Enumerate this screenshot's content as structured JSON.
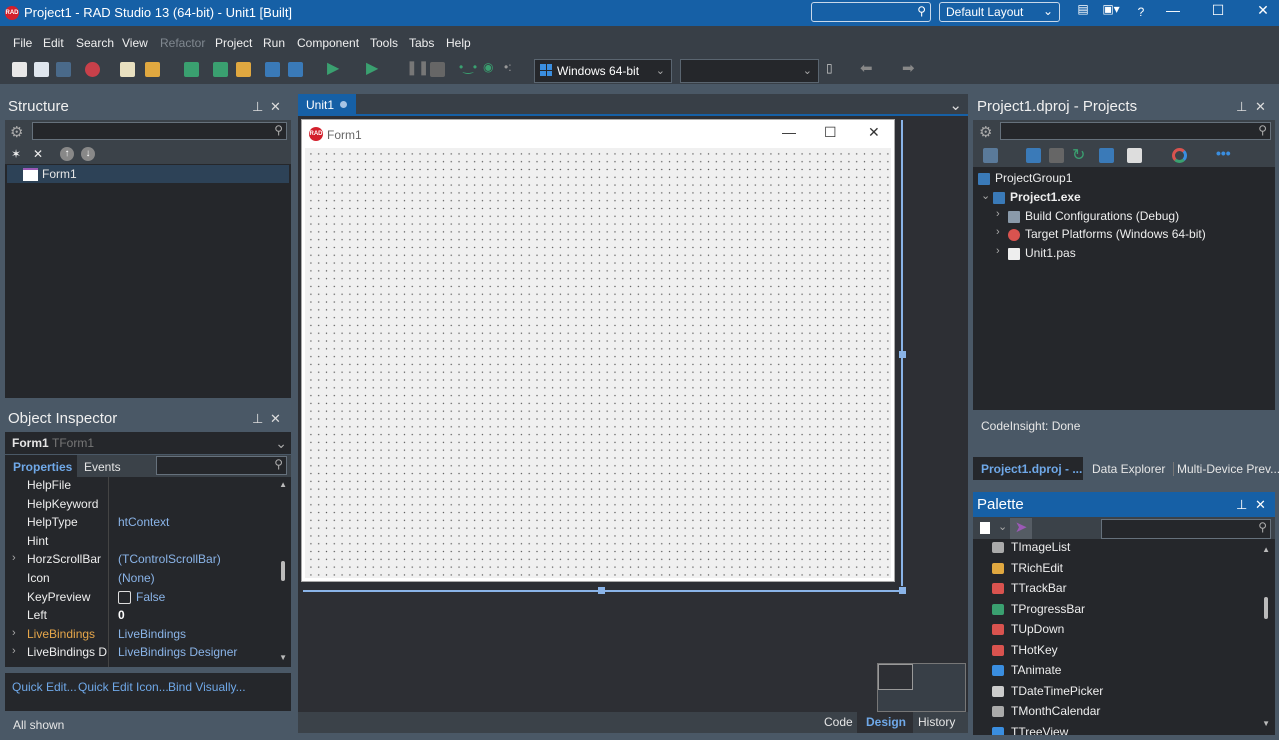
{
  "title_bar": {
    "title": "Project1 - RAD Studio 13 (64-bit) - Unit1 [Built]",
    "search_placeholder": "",
    "layout": "Default Layout",
    "help": "?"
  },
  "menu": [
    "File",
    "Edit",
    "Search",
    "View",
    "Refactor",
    "Project",
    "Run",
    "Component",
    "Tools",
    "Tabs",
    "Help"
  ],
  "menu_disabled": [
    "Refactor"
  ],
  "toolbar": {
    "platform": "Windows 64-bit",
    "config": ""
  },
  "structure": {
    "title": "Structure",
    "items": [
      "Form1"
    ]
  },
  "object_inspector": {
    "title": "Object Inspector",
    "object_name": "Form1",
    "object_type": "TForm1",
    "tabs": [
      "Properties",
      "Events"
    ],
    "properties": [
      {
        "name": "HelpFile",
        "value": "",
        "expandable": false
      },
      {
        "name": "HelpKeyword",
        "value": "",
        "expandable": false
      },
      {
        "name": "HelpType",
        "value": "htContext",
        "expandable": false
      },
      {
        "name": "Hint",
        "value": "",
        "expandable": false
      },
      {
        "name": "HorzScrollBar",
        "value": "(TControlScrollBar)",
        "expandable": true
      },
      {
        "name": "Icon",
        "value": "(None)",
        "expandable": false
      },
      {
        "name": "KeyPreview",
        "value": "False",
        "expandable": false,
        "checkbox": true
      },
      {
        "name": "Left",
        "value": "0",
        "expandable": false
      },
      {
        "name": "LiveBindings",
        "value": "LiveBindings",
        "expandable": true
      },
      {
        "name": "LiveBindings Designer",
        "value": "LiveBindings Designer",
        "expandable": true
      }
    ],
    "links": [
      "Quick Edit...",
      "Quick Edit Icon...",
      "Bind Visually..."
    ],
    "status": "All shown"
  },
  "editor": {
    "tab": "Unit1",
    "form_caption": "Form1",
    "bottom_tabs": [
      "Code",
      "Design",
      "History"
    ],
    "active_bottom_tab": "Design"
  },
  "projects": {
    "title": "Project1.dproj - Projects",
    "tree": [
      {
        "label": "ProjectGroup1",
        "level": 0
      },
      {
        "label": "Project1.exe",
        "level": 1,
        "bold": true
      },
      {
        "label": "Build Configurations (Debug)",
        "level": 2
      },
      {
        "label": "Target Platforms (Windows 64-bit)",
        "level": 2
      },
      {
        "label": "Unit1.pas",
        "level": 2
      }
    ],
    "status": "CodeInsight: Done",
    "tabs": [
      "Project1.dproj - ...",
      "Data Explorer",
      "Multi-Device Prev..."
    ]
  },
  "palette": {
    "title": "Palette",
    "items": [
      "TImageList",
      "TRichEdit",
      "TTrackBar",
      "TProgressBar",
      "TUpDown",
      "THotKey",
      "TAnimate",
      "TDateTimePicker",
      "TMonthCalendar",
      "TTreeView"
    ]
  },
  "colors": {
    "accent": "#1660a6",
    "link": "#6fa8e8",
    "highlight": "#e6a64a"
  }
}
